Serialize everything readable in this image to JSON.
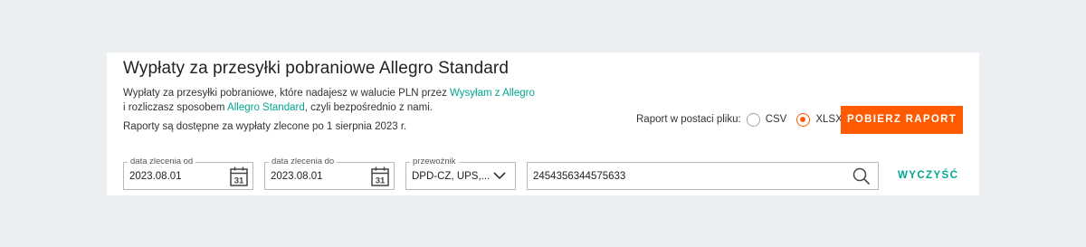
{
  "header": {
    "title": "Wypłaty za przesyłki pobraniowe Allegro Standard"
  },
  "description": {
    "line1_prefix": "Wypłaty za przesyłki pobraniowe, które nadajesz w walucie PLN przez ",
    "line1_link": "Wysyłam z Allegro",
    "line2_prefix": "i rozliczasz sposobem ",
    "line2_link": "Allegro Standard",
    "line2_suffix": ", czyli bezpośrednio z nami.",
    "availability": "Raporty są dostępne za wypłaty zlecone po 1 sierpnia 2023 r."
  },
  "report_format": {
    "label": "Raport w postaci pliku:",
    "options": [
      {
        "label": "CSV",
        "selected": false
      },
      {
        "label": "XLSX",
        "selected": true
      }
    ],
    "download_label": "POBIERZ RAPORT"
  },
  "filters": {
    "date_from": {
      "legend": "data zlecenia od",
      "value": "2023.08.01",
      "icon": "calendar-icon",
      "icon_text": "31"
    },
    "date_to": {
      "legend": "data zlecenia do",
      "value": "2023.08.01",
      "icon": "calendar-icon",
      "icon_text": "31"
    },
    "carrier": {
      "legend": "przewoźnik",
      "value": "DPD-CZ, UPS,...",
      "icon": "chevron-down-icon"
    },
    "search": {
      "value": "2454356344575633",
      "icon": "search-icon"
    },
    "clear_label": "WYCZYŚĆ"
  },
  "colors": {
    "accent": "#ff5a00",
    "link": "#00a790",
    "background": "#eceff1"
  }
}
